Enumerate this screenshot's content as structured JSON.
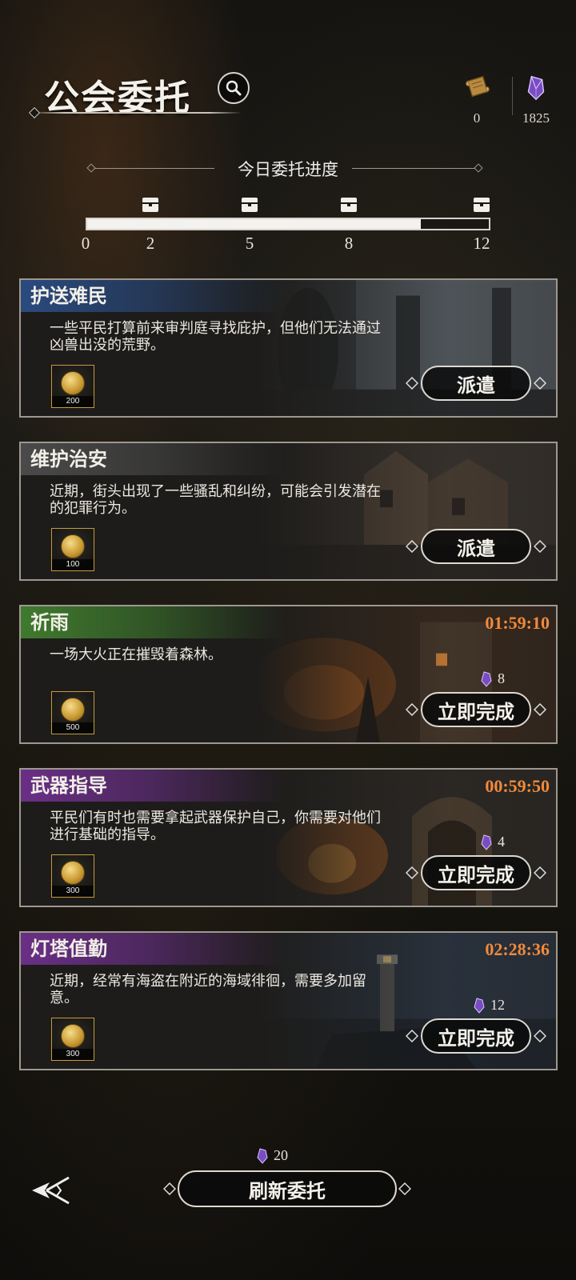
{
  "header": {
    "title": "公会委托",
    "currencies": [
      {
        "icon": "scroll-icon",
        "value": "0"
      },
      {
        "icon": "purple-crystal-icon",
        "value": "1825"
      }
    ]
  },
  "progress": {
    "title": "今日委托进度",
    "current_fraction": 0.83,
    "ticks": [
      "0",
      "2",
      "5",
      "8",
      "12"
    ]
  },
  "quests": [
    {
      "name": "护送难民",
      "tag_color": "blue",
      "description": "一些平民打算前来审判庭寻找庇护，但他们无法通过凶兽出没的荒野。",
      "reward_qty": "200",
      "action": "派遣",
      "timer": "",
      "cost": ""
    },
    {
      "name": "维护治安",
      "tag_color": "gray",
      "description": "近期，街头出现了一些骚乱和纠纷，可能会引发潜在的犯罪行为。",
      "reward_qty": "100",
      "action": "派遣",
      "timer": "",
      "cost": ""
    },
    {
      "name": "祈雨",
      "tag_color": "green",
      "description": "一场大火正在摧毁着森林。",
      "reward_qty": "500",
      "action": "立即完成",
      "timer": "01:59:10",
      "cost": "8"
    },
    {
      "name": "武器指导",
      "tag_color": "purple",
      "description": "平民们有时也需要拿起武器保护自己，你需要对他们进行基础的指导。",
      "reward_qty": "300",
      "action": "立即完成",
      "timer": "00:59:50",
      "cost": "4"
    },
    {
      "name": "灯塔值勤",
      "tag_color": "purple",
      "description": "近期，经常有海盗在附近的海域徘徊，需要多加留意。",
      "reward_qty": "300",
      "action": "立即完成",
      "timer": "02:28:36",
      "cost": "12"
    }
  ],
  "footer": {
    "refresh_label": "刷新委托",
    "refresh_cost": "20"
  },
  "colors": {
    "timer": "#f08a3c",
    "tag_blue": "#2a4a7e",
    "tag_gray": "#4a4a4a",
    "tag_green": "#3f7a2e",
    "tag_purple": "#6a2f86"
  }
}
